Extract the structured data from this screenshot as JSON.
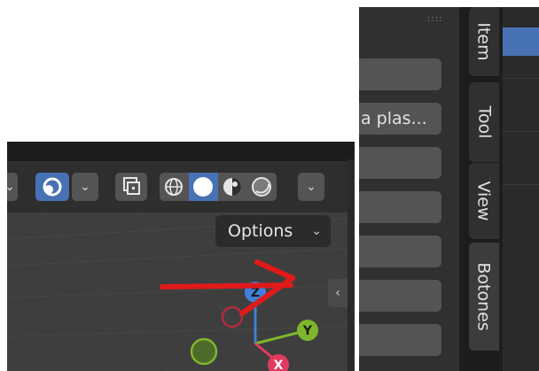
{
  "viewport": {
    "options_label": "Options",
    "chevron": "⌄",
    "side_tab_glyph": "‹",
    "gizmo": {
      "z": "Z",
      "y": "Y",
      "x": "X"
    }
  },
  "sidebar": {
    "field_text": "a plas...",
    "grip": "::::",
    "tabs": [
      {
        "label": "Item"
      },
      {
        "label": "Tool"
      },
      {
        "label": "View"
      },
      {
        "label": "Botones"
      }
    ]
  },
  "colors": {
    "accent": "#4772b3",
    "gizmo_x": "#e33b5f",
    "gizmo_y": "#7fb62c",
    "gizmo_z": "#3f80d9",
    "annotation": "#e01a1a"
  },
  "icons": [
    "viewport-overlay-icon",
    "xray-icon",
    "wireframe-shading-icon",
    "solid-shading-icon",
    "material-shading-icon",
    "rendered-shading-icon"
  ]
}
